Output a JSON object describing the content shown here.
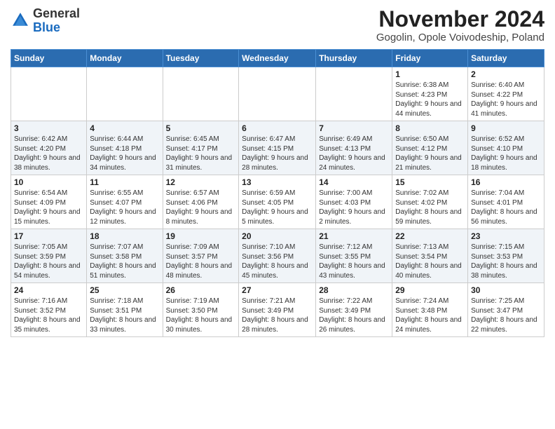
{
  "logo": {
    "general": "General",
    "blue": "Blue"
  },
  "title": "November 2024",
  "subtitle": "Gogolin, Opole Voivodeship, Poland",
  "days_header": [
    "Sunday",
    "Monday",
    "Tuesday",
    "Wednesday",
    "Thursday",
    "Friday",
    "Saturday"
  ],
  "weeks": [
    {
      "days": [
        {
          "num": "",
          "info": ""
        },
        {
          "num": "",
          "info": ""
        },
        {
          "num": "",
          "info": ""
        },
        {
          "num": "",
          "info": ""
        },
        {
          "num": "",
          "info": ""
        },
        {
          "num": "1",
          "sunrise": "Sunrise: 6:38 AM",
          "sunset": "Sunset: 4:23 PM",
          "daylight": "Daylight: 9 hours and 44 minutes."
        },
        {
          "num": "2",
          "sunrise": "Sunrise: 6:40 AM",
          "sunset": "Sunset: 4:22 PM",
          "daylight": "Daylight: 9 hours and 41 minutes."
        }
      ]
    },
    {
      "days": [
        {
          "num": "3",
          "sunrise": "Sunrise: 6:42 AM",
          "sunset": "Sunset: 4:20 PM",
          "daylight": "Daylight: 9 hours and 38 minutes."
        },
        {
          "num": "4",
          "sunrise": "Sunrise: 6:44 AM",
          "sunset": "Sunset: 4:18 PM",
          "daylight": "Daylight: 9 hours and 34 minutes."
        },
        {
          "num": "5",
          "sunrise": "Sunrise: 6:45 AM",
          "sunset": "Sunset: 4:17 PM",
          "daylight": "Daylight: 9 hours and 31 minutes."
        },
        {
          "num": "6",
          "sunrise": "Sunrise: 6:47 AM",
          "sunset": "Sunset: 4:15 PM",
          "daylight": "Daylight: 9 hours and 28 minutes."
        },
        {
          "num": "7",
          "sunrise": "Sunrise: 6:49 AM",
          "sunset": "Sunset: 4:13 PM",
          "daylight": "Daylight: 9 hours and 24 minutes."
        },
        {
          "num": "8",
          "sunrise": "Sunrise: 6:50 AM",
          "sunset": "Sunset: 4:12 PM",
          "daylight": "Daylight: 9 hours and 21 minutes."
        },
        {
          "num": "9",
          "sunrise": "Sunrise: 6:52 AM",
          "sunset": "Sunset: 4:10 PM",
          "daylight": "Daylight: 9 hours and 18 minutes."
        }
      ]
    },
    {
      "days": [
        {
          "num": "10",
          "sunrise": "Sunrise: 6:54 AM",
          "sunset": "Sunset: 4:09 PM",
          "daylight": "Daylight: 9 hours and 15 minutes."
        },
        {
          "num": "11",
          "sunrise": "Sunrise: 6:55 AM",
          "sunset": "Sunset: 4:07 PM",
          "daylight": "Daylight: 9 hours and 12 minutes."
        },
        {
          "num": "12",
          "sunrise": "Sunrise: 6:57 AM",
          "sunset": "Sunset: 4:06 PM",
          "daylight": "Daylight: 9 hours and 8 minutes."
        },
        {
          "num": "13",
          "sunrise": "Sunrise: 6:59 AM",
          "sunset": "Sunset: 4:05 PM",
          "daylight": "Daylight: 9 hours and 5 minutes."
        },
        {
          "num": "14",
          "sunrise": "Sunrise: 7:00 AM",
          "sunset": "Sunset: 4:03 PM",
          "daylight": "Daylight: 9 hours and 2 minutes."
        },
        {
          "num": "15",
          "sunrise": "Sunrise: 7:02 AM",
          "sunset": "Sunset: 4:02 PM",
          "daylight": "Daylight: 8 hours and 59 minutes."
        },
        {
          "num": "16",
          "sunrise": "Sunrise: 7:04 AM",
          "sunset": "Sunset: 4:01 PM",
          "daylight": "Daylight: 8 hours and 56 minutes."
        }
      ]
    },
    {
      "days": [
        {
          "num": "17",
          "sunrise": "Sunrise: 7:05 AM",
          "sunset": "Sunset: 3:59 PM",
          "daylight": "Daylight: 8 hours and 54 minutes."
        },
        {
          "num": "18",
          "sunrise": "Sunrise: 7:07 AM",
          "sunset": "Sunset: 3:58 PM",
          "daylight": "Daylight: 8 hours and 51 minutes."
        },
        {
          "num": "19",
          "sunrise": "Sunrise: 7:09 AM",
          "sunset": "Sunset: 3:57 PM",
          "daylight": "Daylight: 8 hours and 48 minutes."
        },
        {
          "num": "20",
          "sunrise": "Sunrise: 7:10 AM",
          "sunset": "Sunset: 3:56 PM",
          "daylight": "Daylight: 8 hours and 45 minutes."
        },
        {
          "num": "21",
          "sunrise": "Sunrise: 7:12 AM",
          "sunset": "Sunset: 3:55 PM",
          "daylight": "Daylight: 8 hours and 43 minutes."
        },
        {
          "num": "22",
          "sunrise": "Sunrise: 7:13 AM",
          "sunset": "Sunset: 3:54 PM",
          "daylight": "Daylight: 8 hours and 40 minutes."
        },
        {
          "num": "23",
          "sunrise": "Sunrise: 7:15 AM",
          "sunset": "Sunset: 3:53 PM",
          "daylight": "Daylight: 8 hours and 38 minutes."
        }
      ]
    },
    {
      "days": [
        {
          "num": "24",
          "sunrise": "Sunrise: 7:16 AM",
          "sunset": "Sunset: 3:52 PM",
          "daylight": "Daylight: 8 hours and 35 minutes."
        },
        {
          "num": "25",
          "sunrise": "Sunrise: 7:18 AM",
          "sunset": "Sunset: 3:51 PM",
          "daylight": "Daylight: 8 hours and 33 minutes."
        },
        {
          "num": "26",
          "sunrise": "Sunrise: 7:19 AM",
          "sunset": "Sunset: 3:50 PM",
          "daylight": "Daylight: 8 hours and 30 minutes."
        },
        {
          "num": "27",
          "sunrise": "Sunrise: 7:21 AM",
          "sunset": "Sunset: 3:49 PM",
          "daylight": "Daylight: 8 hours and 28 minutes."
        },
        {
          "num": "28",
          "sunrise": "Sunrise: 7:22 AM",
          "sunset": "Sunset: 3:49 PM",
          "daylight": "Daylight: 8 hours and 26 minutes."
        },
        {
          "num": "29",
          "sunrise": "Sunrise: 7:24 AM",
          "sunset": "Sunset: 3:48 PM",
          "daylight": "Daylight: 8 hours and 24 minutes."
        },
        {
          "num": "30",
          "sunrise": "Sunrise: 7:25 AM",
          "sunset": "Sunset: 3:47 PM",
          "daylight": "Daylight: 8 hours and 22 minutes."
        }
      ]
    }
  ]
}
